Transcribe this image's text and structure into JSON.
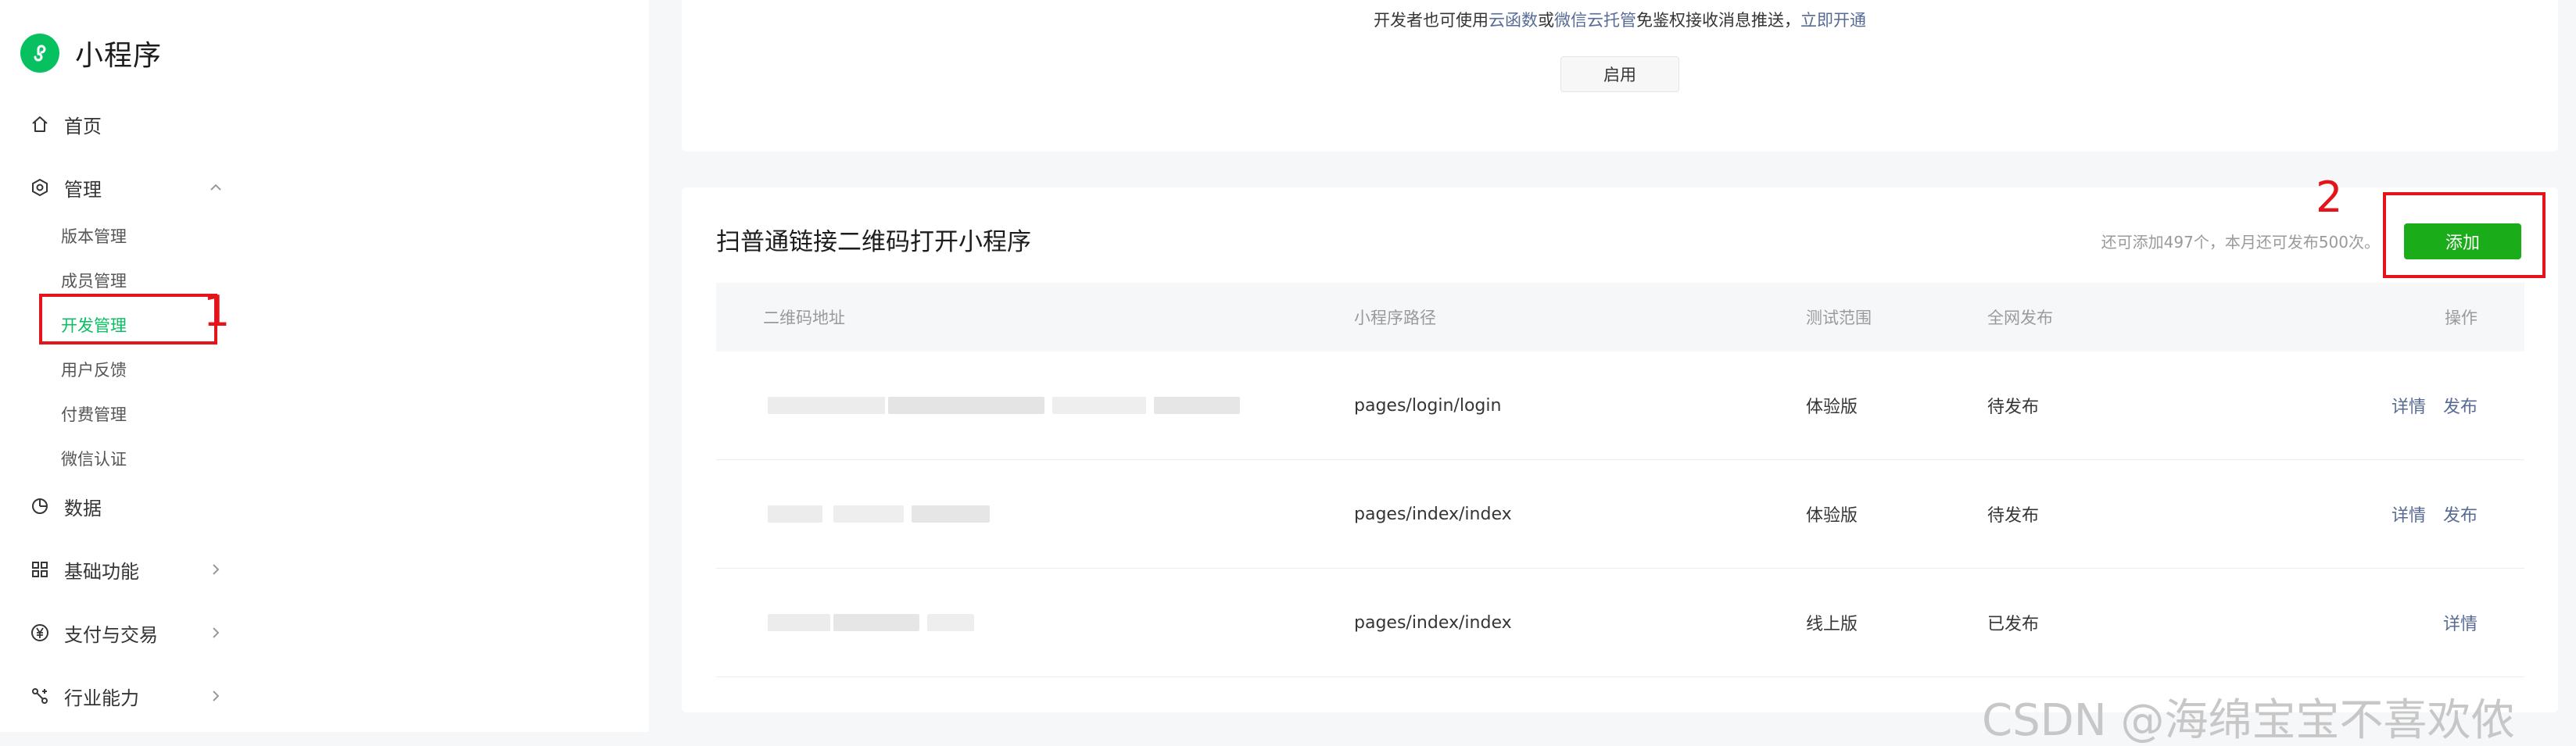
{
  "app": {
    "title": "小程序"
  },
  "sidebar": {
    "home": "首页",
    "manage": "管理",
    "manage_items": [
      "版本管理",
      "成员管理",
      "开发管理",
      "用户反馈",
      "付费管理",
      "微信认证"
    ],
    "data": "数据",
    "basic": "基础功能",
    "payment": "支付与交易",
    "industry": "行业能力"
  },
  "top_card": {
    "notice_prefix": "开发者也可使用",
    "link_cloud_function": "云函数",
    "notice_or": "或",
    "link_cloud_hosting": "微信云托管",
    "notice_suffix": "免鉴权接收消息推送，",
    "link_open_now": "立即开通",
    "enable_label": "启用"
  },
  "main": {
    "title": "扫普通链接二维码打开小程序",
    "quota": "还可添加497个，本月还可发布500次。",
    "add_label": "添加",
    "columns": {
      "qr": "二维码地址",
      "path": "小程序路径",
      "range": "测试范围",
      "publish": "全网发布",
      "ops": "操作"
    },
    "rows": [
      {
        "path": "pages/login/login",
        "range": "体验版",
        "status": "待发布",
        "ops": [
          "详情",
          "发布"
        ]
      },
      {
        "path": "pages/index/index",
        "range": "体验版",
        "status": "待发布",
        "ops": [
          "详情",
          "发布"
        ]
      },
      {
        "path": "pages/index/index",
        "range": "线上版",
        "status": "已发布",
        "ops": [
          "详情"
        ]
      }
    ]
  },
  "annotations": {
    "one": "1",
    "two": "2"
  },
  "watermark": "CSDN @海绵宝宝不喜欢侬",
  "colors": {
    "brand_green": "#07c160",
    "add_button": "#1aad19",
    "link": "#576b95",
    "annotation_red": "#e5141b"
  }
}
